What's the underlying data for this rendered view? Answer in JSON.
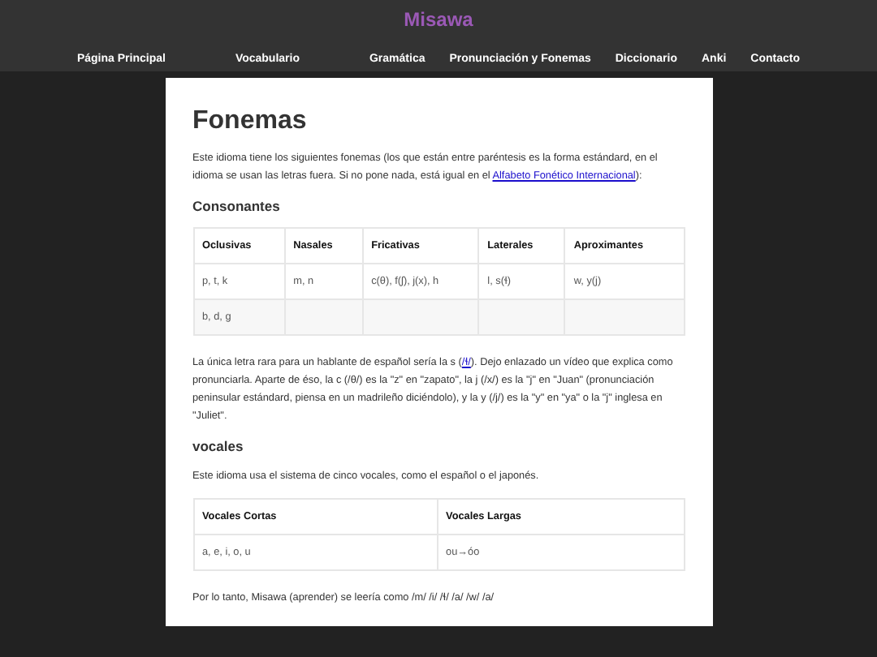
{
  "site_title": "Misawa",
  "nav": [
    {
      "label": "Página Principal"
    },
    {
      "label": "Vocabulario"
    },
    {
      "label": "Gramática"
    },
    {
      "label": "Pronunciación y Fonemas"
    },
    {
      "label": "Diccionario"
    },
    {
      "label": "Anki"
    },
    {
      "label": "Contacto"
    }
  ],
  "heading": "Fonemas",
  "intro": {
    "before": "Este idioma tiene los siguientes fonemas (los que están entre paréntesis es la forma estándard, en el idioma se usan las letras fuera. Si no pone nada, está igual en el ",
    "link": "Alfabeto Fonético Internacional",
    "after": "):"
  },
  "consonants": {
    "title": "Consonantes",
    "columns": [
      "Oclusivas",
      "Nasales",
      "Fricativas",
      "Laterales",
      "Aproximantes"
    ],
    "rows": [
      [
        "p, t, k",
        "m, n",
        "c(θ), f(ʃ), j(x), h",
        "l, s(ɬ)",
        "w, y(j)"
      ],
      [
        "b, d, g",
        "",
        "",
        "",
        ""
      ]
    ]
  },
  "note": {
    "before": "La única letra rara para un hablante de español sería la s (",
    "link": "/ɬ/",
    "after": "). Dejo enlazado un vídeo que explica como pronunciarla. Aparte de éso, la c (/θ/) es la \"z\" en \"zapato\", la j (/x/) es la \"j\" en \"Juan\" (pronunciación peninsular estándard, piensa en un madrileño diciéndolo), y la y (/j/) es la \"y\" en \"ya\" o la \"j\" inglesa en \"Juliet\"."
  },
  "vowels": {
    "title": "vocales",
    "text": "Este idioma usa el sistema de cinco vocales, como el español o el japonés.",
    "columns": [
      "Vocales Cortas",
      "Vocales Largas"
    ],
    "rows": [
      [
        "a, e, i, o, u",
        "ou→óo"
      ]
    ]
  },
  "closing": "Por lo tanto, Misawa (aprender) se leería como /m/ /i/ /ɬ/ /a/ /w/ /a/"
}
